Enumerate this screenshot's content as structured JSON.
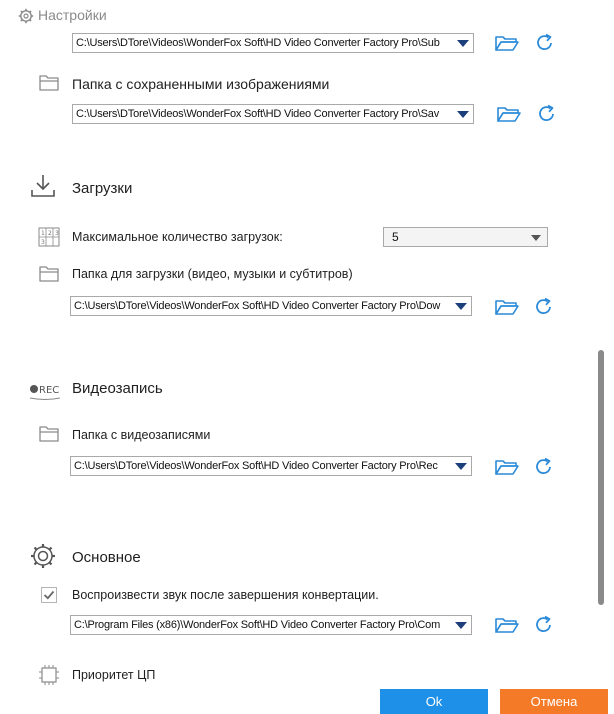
{
  "window": {
    "title": "Настройки"
  },
  "snapshots": {
    "subtitle_path": "C:\\Users\\DTore\\Videos\\WonderFox Soft\\HD Video Converter Factory Pro\\Sub",
    "folder_label": "Папка с сохраненными изображениями",
    "path": "C:\\Users\\DTore\\Videos\\WonderFox Soft\\HD Video Converter Factory Pro\\Sav"
  },
  "downloads": {
    "title": "Загрузки",
    "max_label": "Максимальное количество загрузок:",
    "max_value": "5",
    "folder_label": "Папка для загрузки (видео, музыки и субтитров)",
    "path": "C:\\Users\\DTore\\Videos\\WonderFox Soft\\HD Video Converter Factory Pro\\Dow"
  },
  "recording": {
    "title": "Видеозапись",
    "folder_label": "Папка с видеозаписями",
    "path": "C:\\Users\\DTore\\Videos\\WonderFox Soft\\HD Video Converter Factory Pro\\Rec"
  },
  "general": {
    "title": "Основное",
    "sound_label": "Воспроизвести звук после завершения конвертации.",
    "sound_checked": true,
    "sound_path": "C:\\Program Files (x86)\\WonderFox Soft\\HD Video Converter Factory Pro\\Com",
    "cpu_label": "Приоритет ЦП"
  },
  "footer": {
    "ok_label": "Ok",
    "cancel_label": "Отмена"
  },
  "colors": {
    "accent_blue": "#1e90e8",
    "cancel_orange": "#f57a28",
    "dropdown_arrow": "#1c3e7a"
  }
}
